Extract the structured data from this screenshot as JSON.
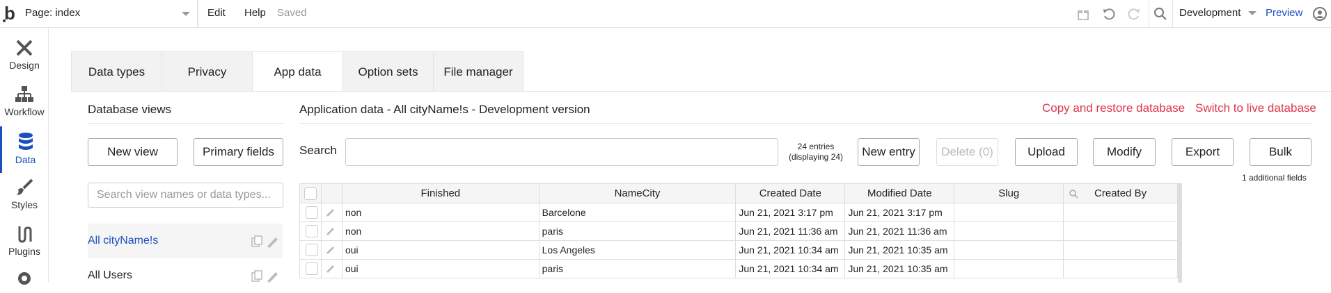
{
  "topbar": {
    "logo": "b",
    "page_label": "Page: index",
    "edit": "Edit",
    "help": "Help",
    "saved": "Saved",
    "environment": "Development",
    "preview": "Preview"
  },
  "sidebar": {
    "items": [
      {
        "label": "Design",
        "icon": "design-icon"
      },
      {
        "label": "Workflow",
        "icon": "workflow-icon"
      },
      {
        "label": "Data",
        "icon": "database-icon",
        "active": true
      },
      {
        "label": "Styles",
        "icon": "brush-icon"
      },
      {
        "label": "Plugins",
        "icon": "plug-icon"
      }
    ]
  },
  "tabs": [
    {
      "label": "Data types"
    },
    {
      "label": "Privacy"
    },
    {
      "label": "App data",
      "active": true
    },
    {
      "label": "Option sets"
    },
    {
      "label": "File manager"
    }
  ],
  "views_panel": {
    "title": "Database views",
    "new_view": "New view",
    "primary_fields": "Primary fields",
    "search_placeholder": "Search view names or data types...",
    "views": [
      {
        "label": "All cityName!s",
        "selected": true
      },
      {
        "label": "All Users",
        "selected": false
      }
    ]
  },
  "main": {
    "title": "Application data - All cityName!s - Development version",
    "copy_restore": "Copy and restore database",
    "switch_live": "Switch to live database",
    "search_label": "Search",
    "entries_line1": "24 entries",
    "entries_line2": "(displaying 24)",
    "new_entry": "New entry",
    "delete": "Delete (0)",
    "upload": "Upload",
    "modify": "Modify",
    "export": "Export",
    "bulk": "Bulk",
    "additional_fields": "1 additional fields"
  },
  "table": {
    "columns": [
      "Finished",
      "NameCity",
      "Created Date",
      "Modified Date",
      "Slug",
      "Created By"
    ],
    "rows": [
      [
        "non",
        "Barcelone",
        "Jun 21, 2021 3:17 pm",
        "Jun 21, 2021 3:17 pm",
        "",
        ""
      ],
      [
        "non",
        "paris",
        "Jun 21, 2021 11:36 am",
        "Jun 21, 2021 11:36 am",
        "",
        ""
      ],
      [
        "oui",
        "Los Angeles",
        "Jun 21, 2021 10:34 am",
        "Jun 21, 2021 10:35 am",
        "",
        ""
      ],
      [
        "oui",
        "paris",
        "Jun 21, 2021 10:34 am",
        "Jun 21, 2021 10:35 am",
        "",
        ""
      ]
    ]
  },
  "colors": {
    "accent": "#1a4fbf",
    "danger_link": "#e0334b"
  }
}
